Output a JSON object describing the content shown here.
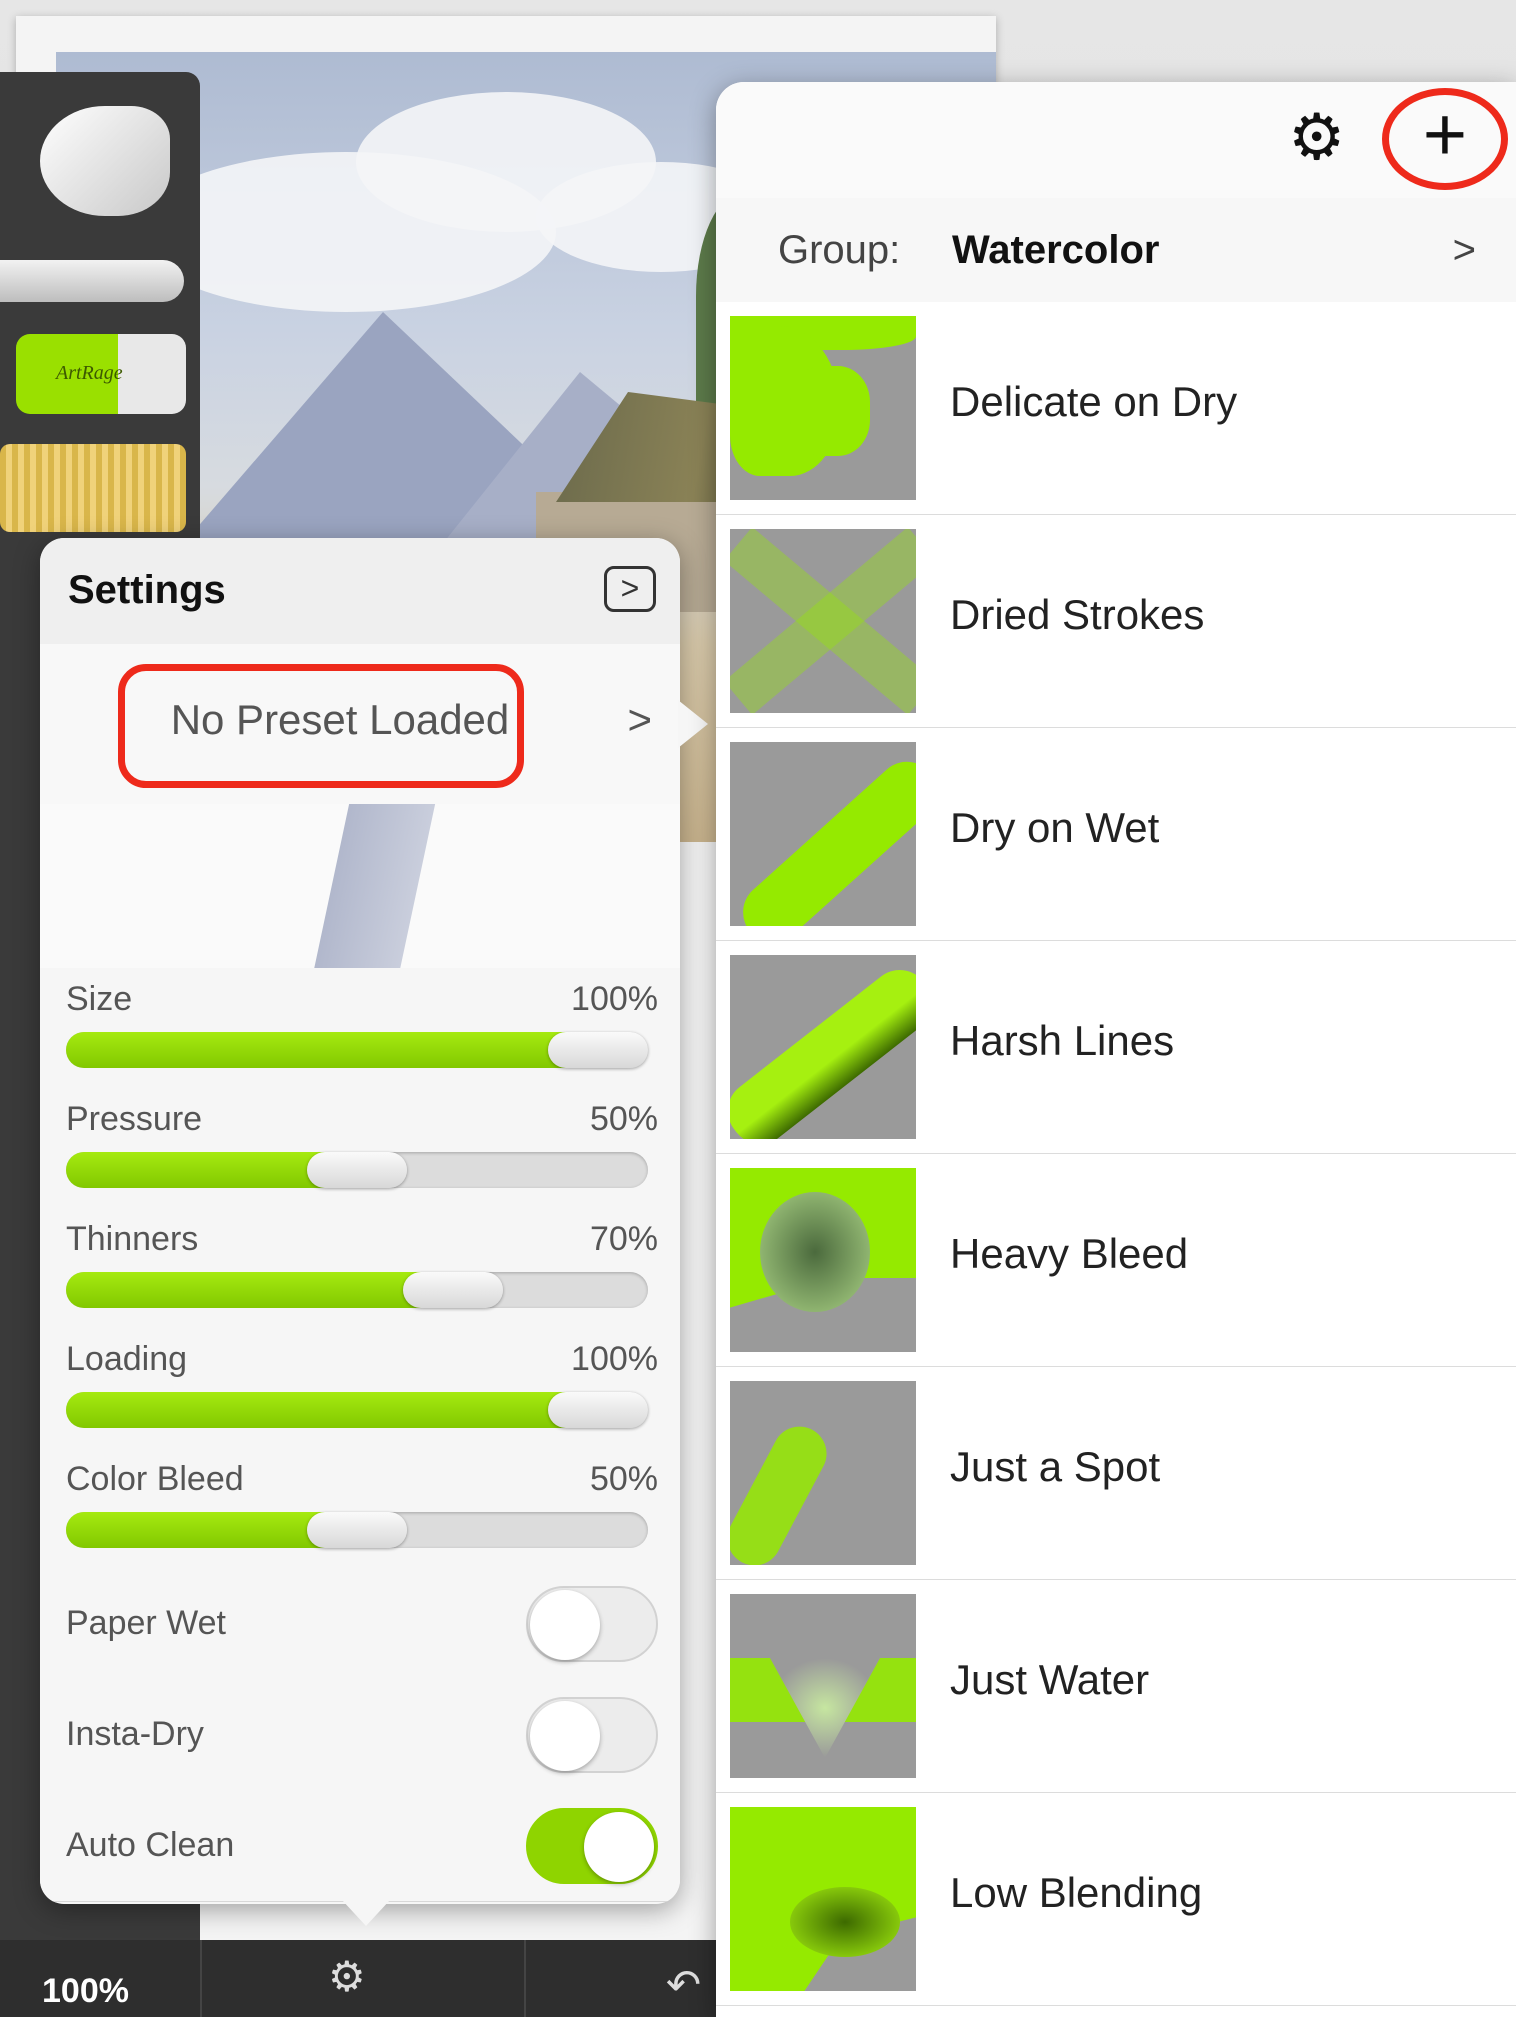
{
  "statusbar": {
    "zoom": "100%"
  },
  "brand": {
    "accent": "#8fd400",
    "highlight": "#ee2a1b"
  },
  "settings": {
    "title": "Settings",
    "expand_icon": ">",
    "preset": {
      "label": "No Preset Loaded",
      "chevron": ">"
    },
    "sliders": [
      {
        "name": "Size",
        "value": "100%",
        "fraction": 1.0
      },
      {
        "name": "Pressure",
        "value": "50%",
        "fraction": 0.5
      },
      {
        "name": "Thinners",
        "value": "70%",
        "fraction": 0.7
      },
      {
        "name": "Loading",
        "value": "100%",
        "fraction": 1.0
      },
      {
        "name": "Color Bleed",
        "value": "50%",
        "fraction": 0.5
      }
    ],
    "toggles": [
      {
        "name": "Paper Wet",
        "on": false
      },
      {
        "name": "Insta-Dry",
        "on": false
      },
      {
        "name": "Auto Clean",
        "on": true
      }
    ]
  },
  "presets_panel": {
    "add_label": "+",
    "group": {
      "label": "Group:",
      "value": "Watercolor",
      "chevron": ">"
    },
    "items": [
      {
        "name": "Delicate on Dry"
      },
      {
        "name": "Dried Strokes"
      },
      {
        "name": "Dry on Wet"
      },
      {
        "name": "Harsh Lines"
      },
      {
        "name": "Heavy Bleed"
      },
      {
        "name": "Just a Spot"
      },
      {
        "name": "Just Water"
      },
      {
        "name": "Low Blending"
      }
    ]
  },
  "toolbar": {
    "eraser_brand": "ArtRage"
  }
}
